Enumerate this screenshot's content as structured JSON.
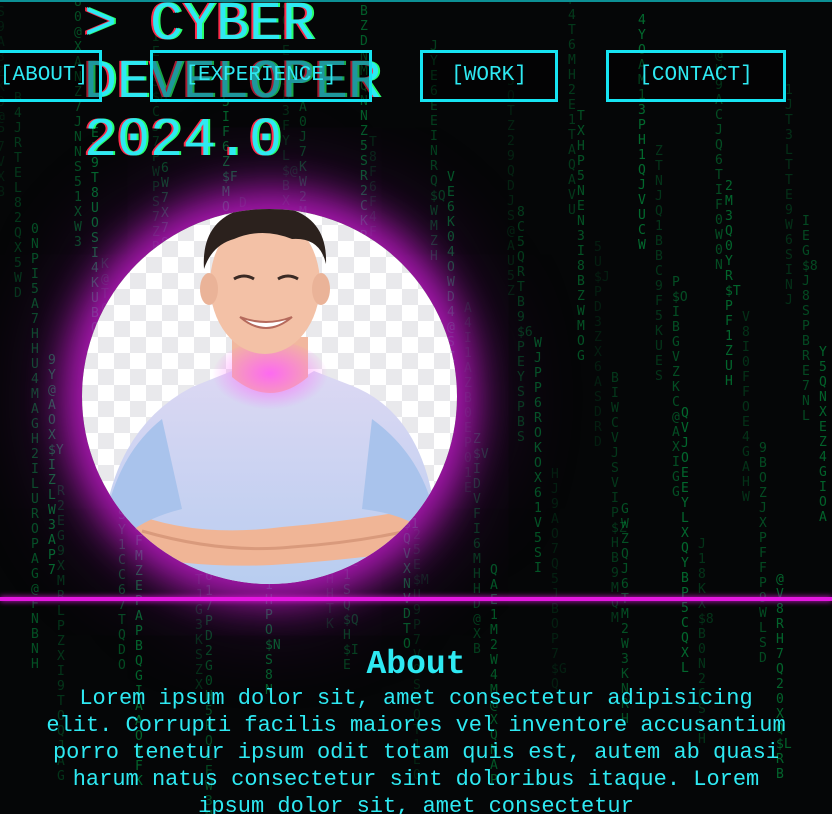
{
  "hero": {
    "title_line1": "> CYBER",
    "title_line2": "DEVELOPER",
    "title_line3": "2024.0"
  },
  "nav": {
    "about": "[ABOUT]",
    "experience": "[EXPERIENCE]",
    "work": "[WORK]",
    "contact": "[CONTACT]"
  },
  "avatar": {
    "alt": "Portrait of a smiling man in a light blue t-shirt with crossed arms"
  },
  "about": {
    "heading": "About",
    "body": "Lorem ipsum dolor sit, amet consectetur adipisicing elit. Corrupti facilis maiores vel inventore accusantium porro tenetur ipsum odit totam quis est, autem ab quasi harum natus consectetur sint doloribus itaque. Lorem ipsum dolor sit, amet consectetur"
  },
  "theme": {
    "background": "#050607",
    "accent_cyan": "#2ee9f2",
    "accent_magenta": "#e417e0",
    "matrix_green": "#00c853"
  },
  "matrix_rain": {
    "columns": [
      "GUMS9A3ZK0@P7VXB",
      "B4JRTEL82QX5WD",
      "0NPI5A7HHU4MAGH2ILUROPAG@FNBNH",
      "9Y@AOX$YIZLW3AP7",
      "R2EG9XMRLPZXI9TOQJAG",
      "U0@XANZ7JNNS51XW3",
      "E59T8UOSI4KUBOUIK",
      "K@T0OVJA3T$ZIVU",
      "ZIO3PEUISY1CC67TQDO",
      "MFMZEPAPBQGIAAOYFK",
      "IEIS$OCJ7PWPS7ZBV",
      "6W7X78IK@3IGHA6A",
      "Y8T5Y3PP0UA6YVQV",
      "3J67KBUMGYTJG3KSZX",
      "F617PD2G0H5RQLEW3M",
      "7K5IF6Z$FMOB3SEOIM",
      "DLC1ZB1YCR7EAHSPUO",
      "C6YBPAIDW2MLRA8S9",
      "5TRNWXYL1HPO$NS8N",
      "7D4O5E3JB3FYL$@BX",
      "A0J7KW2M0$FIGEDAXSI",
      "QMO8RDBJLBZVWPLF4Q",
      "1A7I4RDBIV3BAUHHTK",
      "O$IF2$@1SQ$QH$IE",
      "BZDNMQNNZ5SR2CKRF",
      "T8F6F4FE4HQ1QPJZIK",
      "PEXY8@AVZAE9JB0M",
      "8LEEOJV3$1QVXNVDTO",
      "25E$MU9P7V0SQQT1E0",
      "JYE6EEINRQ$QWMZH",
      "VE6K04OWD4@SZVXR",
      "A4I1AZB0EP01E",
      "Z$VIDVFI6MHHD@XB",
      "QAE1M2W4M@XQNAP",
      "5QTZ29QDJS@AU5Z",
      "8C5QRTB9$6PEYSPBS",
      "WJPP6ROKOX61V5SI",
      "HJ9AO7Q5JBOP7$GQ",
      "RF4T6MH2E1TAQAVU",
      "TXHP5NEN3I8BZWMOG",
      "5U$JPD3ZX6ASDRD",
      "BIWCVJSVIP$ZHB9MQM",
      "GWZQJ6TM2W3KNRH",
      "4YOAM13PH1QJVUCW",
      "ZTNJQ1BBC9F5KUES",
      "P$OIBGVZKC@AXIGG",
      "QVJOEEYLXQYBP5CQXL",
      "J18KX$8B0N26SLH",
      "@U9ACJQ6TIF0W0N",
      "2M3Q0YR$TPF1ZUH",
      "V8I0FFOE4GAHW",
      "9BOZJXPFFP9WLSD",
      "@V8RH7Q20XQ$LRB",
      "1JT3LTTE9W6SINJ",
      "IEG$8J8SPBRE7NL",
      "Y5QNXEZ4GIOA"
    ]
  }
}
